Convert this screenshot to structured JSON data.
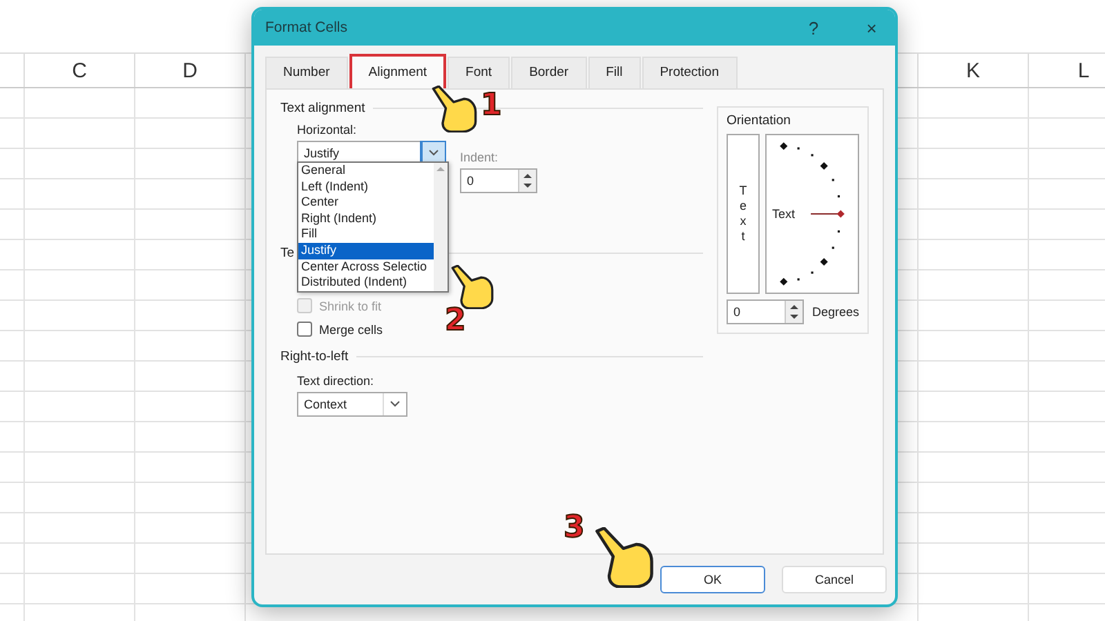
{
  "window": {
    "title": "Format Cells",
    "help": "?",
    "close": "×"
  },
  "sheet": {
    "columns": [
      {
        "label": "C"
      },
      {
        "label": "D"
      },
      {
        "label": "K"
      },
      {
        "label": "L"
      }
    ]
  },
  "tabs": [
    {
      "label": "Number",
      "selected": false,
      "highlighted": false
    },
    {
      "label": "Alignment",
      "selected": true,
      "highlighted": true
    },
    {
      "label": "Font",
      "selected": false,
      "highlighted": false
    },
    {
      "label": "Border",
      "selected": false,
      "highlighted": false
    },
    {
      "label": "Fill",
      "selected": false,
      "highlighted": false
    },
    {
      "label": "Protection",
      "selected": false,
      "highlighted": false
    }
  ],
  "text_alignment": {
    "heading": "Text alignment",
    "horizontal": {
      "label": "Horizontal:",
      "value": "Justify",
      "expanded": true,
      "options": [
        {
          "label": "General",
          "selected": false
        },
        {
          "label": "Left (Indent)",
          "selected": false
        },
        {
          "label": "Center",
          "selected": false
        },
        {
          "label": "Right (Indent)",
          "selected": false
        },
        {
          "label": "Fill",
          "selected": false
        },
        {
          "label": "Justify",
          "selected": true
        },
        {
          "label": "Center Across Selectio",
          "selected": false
        },
        {
          "label": "Distributed (Indent)",
          "selected": false
        }
      ]
    },
    "indent": {
      "label": "Indent:",
      "value": "0"
    }
  },
  "text_control": {
    "heading": "Te",
    "checkboxes": [
      {
        "label": "Shrink to fit",
        "checked": false,
        "disabled": true
      },
      {
        "label": "Merge cells",
        "checked": false,
        "disabled": false
      }
    ]
  },
  "right_to_left": {
    "heading": "Right-to-left",
    "text_direction": {
      "label": "Text direction:",
      "value": "Context"
    }
  },
  "orientation": {
    "heading": "Orientation",
    "vertical_text": "Text",
    "dial_text": "Text",
    "degrees": {
      "value": "0",
      "label": "Degrees"
    }
  },
  "buttons": [
    {
      "label": "OK",
      "default": true
    },
    {
      "label": "Cancel",
      "default": false
    }
  ],
  "callouts": [
    {
      "number": "1"
    },
    {
      "number": "2"
    },
    {
      "number": "3"
    }
  ]
}
